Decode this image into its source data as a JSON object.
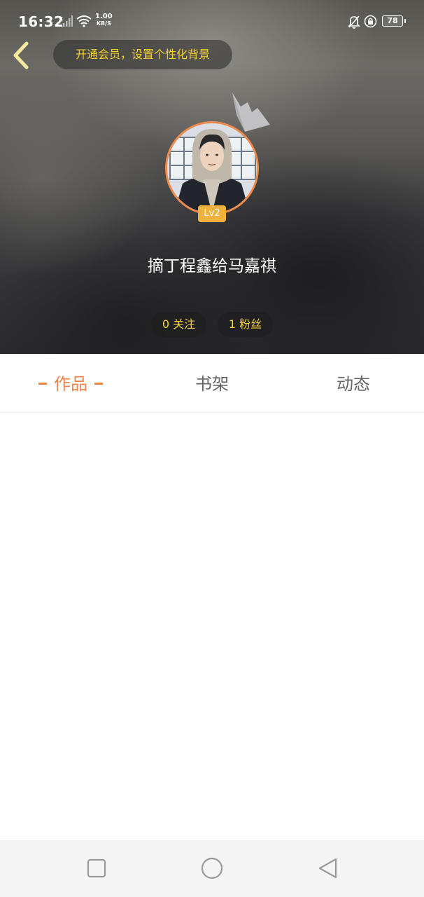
{
  "status_bar": {
    "time": "16:32",
    "speed_value": "1.00",
    "speed_unit": "KB/S",
    "battery": "78",
    "icons": [
      "signal-icon",
      "wifi-icon",
      "mute-bell-icon",
      "lock-rotation-icon",
      "battery-icon"
    ]
  },
  "header": {
    "back_icon": "chevron-left-icon",
    "vip_banner": "开通会员，设置个性化背景",
    "crown_icon": "crown-icon",
    "level": "Lv2",
    "username": "摘丁程鑫给马嘉祺",
    "following": "0 关注",
    "fans": "1 粉丝"
  },
  "tabs": [
    {
      "label": "作品",
      "active": true
    },
    {
      "label": "书架",
      "active": false
    },
    {
      "label": "动态",
      "active": false
    }
  ],
  "colors": {
    "accent": "#f0844a",
    "gold_text": "#f4cf2e",
    "level_badge": "#f0b23c",
    "tab_inactive": "#666666"
  },
  "nav_bar": {
    "icons": [
      "recent-apps-icon",
      "home-icon",
      "back-triangle-icon"
    ]
  }
}
